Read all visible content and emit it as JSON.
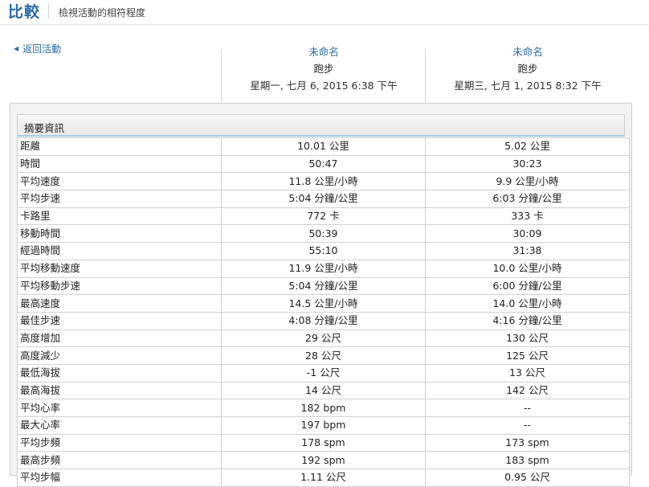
{
  "header": {
    "title": "比較",
    "subtitle": "檢視活動的相符程度"
  },
  "nav": {
    "back_label": "返回活動"
  },
  "activities": [
    {
      "name": "未命名",
      "type": "跑步",
      "date": "星期一, 七月 6, 2015 6:38 下午"
    },
    {
      "name": "未命名",
      "type": "跑步",
      "date": "星期三, 七月 1, 2015 8:32 下午"
    }
  ],
  "summary": {
    "title": "摘要資訊",
    "rows": [
      {
        "label": "距離",
        "a": "10.01 公里",
        "b": "5.02 公里"
      },
      {
        "label": "時間",
        "a": "50:47",
        "b": "30:23"
      },
      {
        "label": "平均速度",
        "a": "11.8 公里/小時",
        "b": "9.9 公里/小時"
      },
      {
        "label": "平均步速",
        "a": "5:04 分鐘/公里",
        "b": "6:03 分鐘/公里"
      },
      {
        "label": "卡路里",
        "a": "772 卡",
        "b": "333 卡"
      },
      {
        "label": "移動時間",
        "a": "50:39",
        "b": "30:09"
      },
      {
        "label": "經過時間",
        "a": "55:10",
        "b": "31:38"
      },
      {
        "label": "平均移動速度",
        "a": "11.9 公里/小時",
        "b": "10.0 公里/小時"
      },
      {
        "label": "平均移動步速",
        "a": "5:04 分鐘/公里",
        "b": "6:00 分鐘/公里"
      },
      {
        "label": "最高速度",
        "a": "14.5 公里/小時",
        "b": "14.0 公里/小時"
      },
      {
        "label": "最佳步速",
        "a": "4:08 分鐘/公里",
        "b": "4:16 分鐘/公里"
      },
      {
        "label": "高度增加",
        "a": "29 公尺",
        "b": "130 公尺"
      },
      {
        "label": "高度減少",
        "a": "28 公尺",
        "b": "125 公尺"
      },
      {
        "label": "最低海拔",
        "a": "-1 公尺",
        "b": "13 公尺"
      },
      {
        "label": "最高海拔",
        "a": "14 公尺",
        "b": "142 公尺"
      },
      {
        "label": "平均心率",
        "a": "182 bpm",
        "b": "--"
      },
      {
        "label": "最大心率",
        "a": "197 bpm",
        "b": "--"
      },
      {
        "label": "平均步頻",
        "a": "178 spm",
        "b": "173 spm"
      },
      {
        "label": "最高步頻",
        "a": "192 spm",
        "b": "183 spm"
      },
      {
        "label": "平均步幅",
        "a": "1.11 公尺",
        "b": "0.95 公尺"
      }
    ]
  },
  "colors": {
    "accent": "#2a6aa6",
    "panel_bg": "#f2f2f2",
    "header_underline": "#a9cfe6"
  }
}
